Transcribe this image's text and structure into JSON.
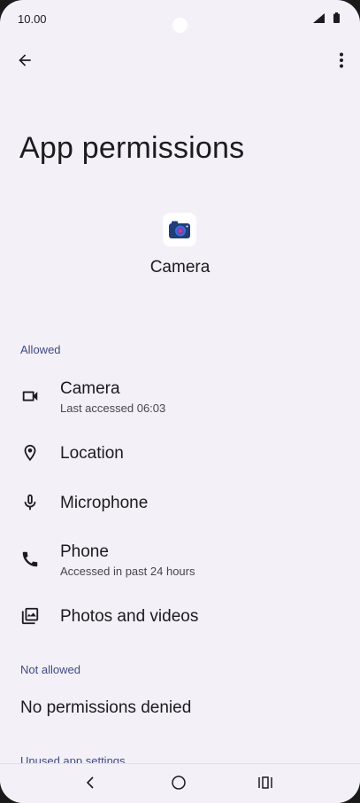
{
  "status_bar": {
    "time": "10.00",
    "icons": [
      "signal-icon",
      "battery-icon"
    ]
  },
  "top_bar": {
    "back_icon": "arrow-back-icon",
    "more_icon": "more-vert-icon"
  },
  "page": {
    "title": "App permissions",
    "app_name": "Camera",
    "app_icon": "camera-app-icon"
  },
  "sections": {
    "allowed": "Allowed",
    "not_allowed": "Not allowed",
    "unused": "Unused app settings"
  },
  "permissions": [
    {
      "label": "Camera",
      "sub": "Last accessed 06:03",
      "icon": "videocam-icon"
    },
    {
      "label": "Location",
      "sub": "",
      "icon": "location-pin-icon"
    },
    {
      "label": "Microphone",
      "sub": "",
      "icon": "microphone-icon"
    },
    {
      "label": "Phone",
      "sub": "Accessed in past 24 hours",
      "icon": "phone-icon"
    },
    {
      "label": "Photos and videos",
      "sub": "",
      "icon": "photos-icon"
    }
  ],
  "not_allowed_text": "No permissions denied",
  "nav": {
    "back_icon": "nav-back-icon",
    "home_icon": "nav-home-icon",
    "recents_icon": "nav-recents-icon"
  },
  "colors": {
    "background": "#f3f0f7",
    "section_header": "#3e4a86",
    "text": "#1c1b1f"
  }
}
